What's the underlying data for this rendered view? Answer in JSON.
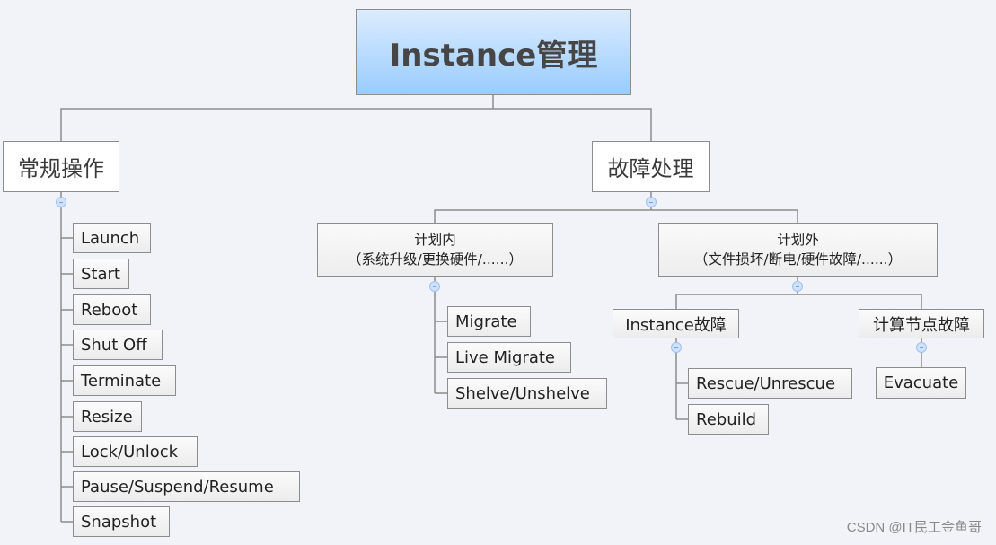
{
  "root": {
    "title": "Instance管理"
  },
  "branches": {
    "routine": {
      "title": "常规操作",
      "items": [
        "Launch",
        "Start",
        "Reboot",
        "Shut Off",
        "Terminate",
        "Resize",
        "Lock/Unlock",
        "Pause/Suspend/Resume",
        "Snapshot"
      ]
    },
    "fault": {
      "title": "故障处理",
      "planned": {
        "title": "计划内",
        "subtitle": "（系统升级/更换硬件/......）",
        "items": [
          "Migrate",
          "Live Migrate",
          "Shelve/Unshelve"
        ]
      },
      "unplanned": {
        "title": "计划外",
        "subtitle": "（文件损坏/断电/硬件故障/......）",
        "instance_fault": {
          "title": "Instance故障",
          "items": [
            "Rescue/Unrescue",
            "Rebuild"
          ]
        },
        "node_fault": {
          "title": "计算节点故障",
          "items": [
            "Evacuate"
          ]
        }
      }
    }
  },
  "watermark": "CSDN @IT民工金鱼哥",
  "colors": {
    "root_top": "#dcecfd",
    "root_bottom": "#99ccff",
    "line": "#8c8c8c",
    "background": "#f2f3f8"
  }
}
